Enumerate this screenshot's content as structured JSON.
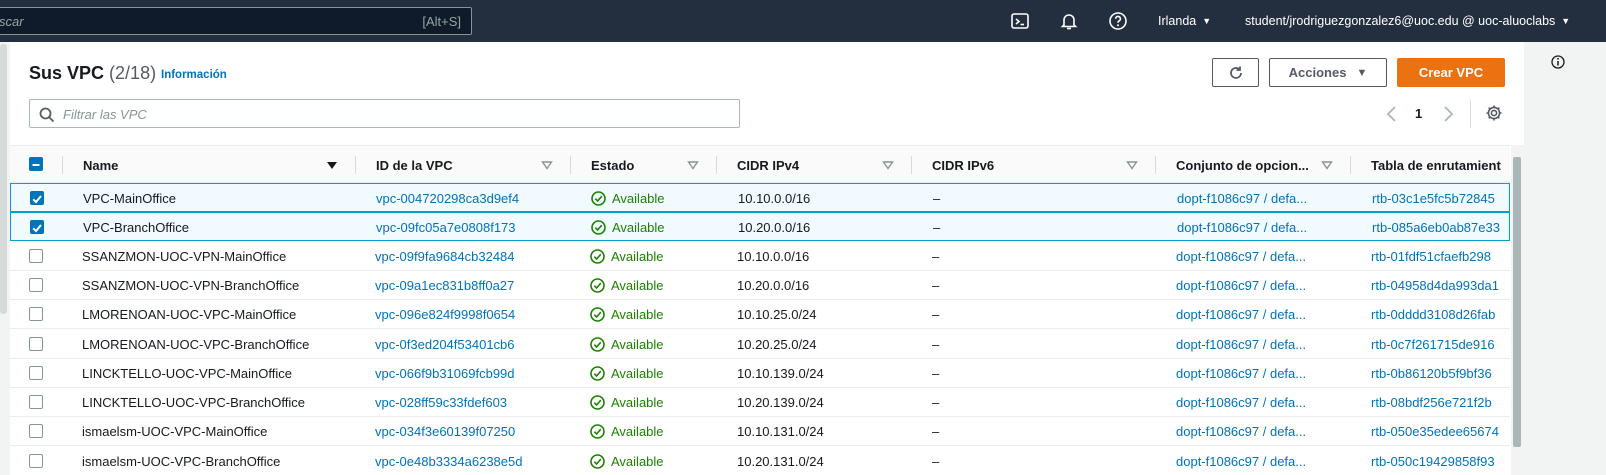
{
  "topbar": {
    "search_placeholder": "scar",
    "search_shortcut": "[Alt+S]",
    "region": "Irlanda",
    "account": "student/jrodriguezgonzalez6@uoc.edu @ uoc-aluoclabs"
  },
  "header": {
    "title": "Sus VPC",
    "count": "(2/18)",
    "info_link": "Información",
    "actions_label": "Acciones",
    "create_label": "Crear VPC"
  },
  "filter": {
    "placeholder": "Filtrar las VPC"
  },
  "pagination": {
    "page": "1"
  },
  "columns": [
    "Name",
    "ID de la VPC",
    "Estado",
    "CIDR IPv4",
    "CIDR IPv6",
    "Conjunto de opcion...",
    "Tabla de enrutamient"
  ],
  "rows": [
    {
      "selected": true,
      "name": "VPC-MainOffice",
      "id": "vpc-004720298ca3d9ef4",
      "status": "Available",
      "ipv4": "10.10.0.0/16",
      "ipv6": "–",
      "dhcp": "dopt-f1086c97 / defa...",
      "rtb": "rtb-03c1e5fc5b72845"
    },
    {
      "selected": true,
      "name": "VPC-BranchOffice",
      "id": "vpc-09fc05a7e0808f173",
      "status": "Available",
      "ipv4": "10.20.0.0/16",
      "ipv6": "–",
      "dhcp": "dopt-f1086c97 / defa...",
      "rtb": "rtb-085a6eb0ab87e33"
    },
    {
      "selected": false,
      "name": "SSANZMON-UOC-VPN-MainOffice",
      "id": "vpc-09f9fa9684cb32484",
      "status": "Available",
      "ipv4": "10.10.0.0/16",
      "ipv6": "–",
      "dhcp": "dopt-f1086c97 / defa...",
      "rtb": "rtb-01fdf51cfaefb298"
    },
    {
      "selected": false,
      "name": "SSANZMON-UOC-VPN-BranchOffice",
      "id": "vpc-09a1ec831b8ff0a27",
      "status": "Available",
      "ipv4": "10.20.0.0/16",
      "ipv6": "–",
      "dhcp": "dopt-f1086c97 / defa...",
      "rtb": "rtb-04958d4da993da1"
    },
    {
      "selected": false,
      "name": "LMORENOAN-UOC-VPC-MainOffice",
      "id": "vpc-096e824f9998f0654",
      "status": "Available",
      "ipv4": "10.10.25.0/24",
      "ipv6": "–",
      "dhcp": "dopt-f1086c97 / defa...",
      "rtb": "rtb-0dddd3108d26fab"
    },
    {
      "selected": false,
      "name": "LMORENOAN-UOC-VPC-BranchOffice",
      "id": "vpc-0f3ed204f53401cb6",
      "status": "Available",
      "ipv4": "10.20.25.0/24",
      "ipv6": "–",
      "dhcp": "dopt-f1086c97 / defa...",
      "rtb": "rtb-0c7f261715de916"
    },
    {
      "selected": false,
      "name": "LINCKTELLO-UOC-VPC-MainOffice",
      "id": "vpc-066f9b31069fcb99d",
      "status": "Available",
      "ipv4": "10.10.139.0/24",
      "ipv6": "–",
      "dhcp": "dopt-f1086c97 / defa...",
      "rtb": "rtb-0b86120b5f9bf36"
    },
    {
      "selected": false,
      "name": "LINCKTELLO-UOC-VPC-BranchOffice",
      "id": "vpc-028ff59c33fdef603",
      "status": "Available",
      "ipv4": "10.20.139.0/24",
      "ipv6": "–",
      "dhcp": "dopt-f1086c97 / defa...",
      "rtb": "rtb-08bdf256e721f2b"
    },
    {
      "selected": false,
      "name": "ismaelsm-UOC-VPC-MainOffice",
      "id": "vpc-034f3e60139f07250",
      "status": "Available",
      "ipv4": "10.10.131.0/24",
      "ipv6": "–",
      "dhcp": "dopt-f1086c97 / defa...",
      "rtb": "rtb-050e35edee65674"
    },
    {
      "selected": false,
      "name": "ismaelsm-UOC-VPC-BranchOffice",
      "id": "vpc-0e48b3334a6238e5d",
      "status": "Available",
      "ipv4": "10.20.131.0/24",
      "ipv6": "–",
      "dhcp": "dopt-f1086c97 / defa...",
      "rtb": "rtb-050c19429858f93"
    }
  ]
}
